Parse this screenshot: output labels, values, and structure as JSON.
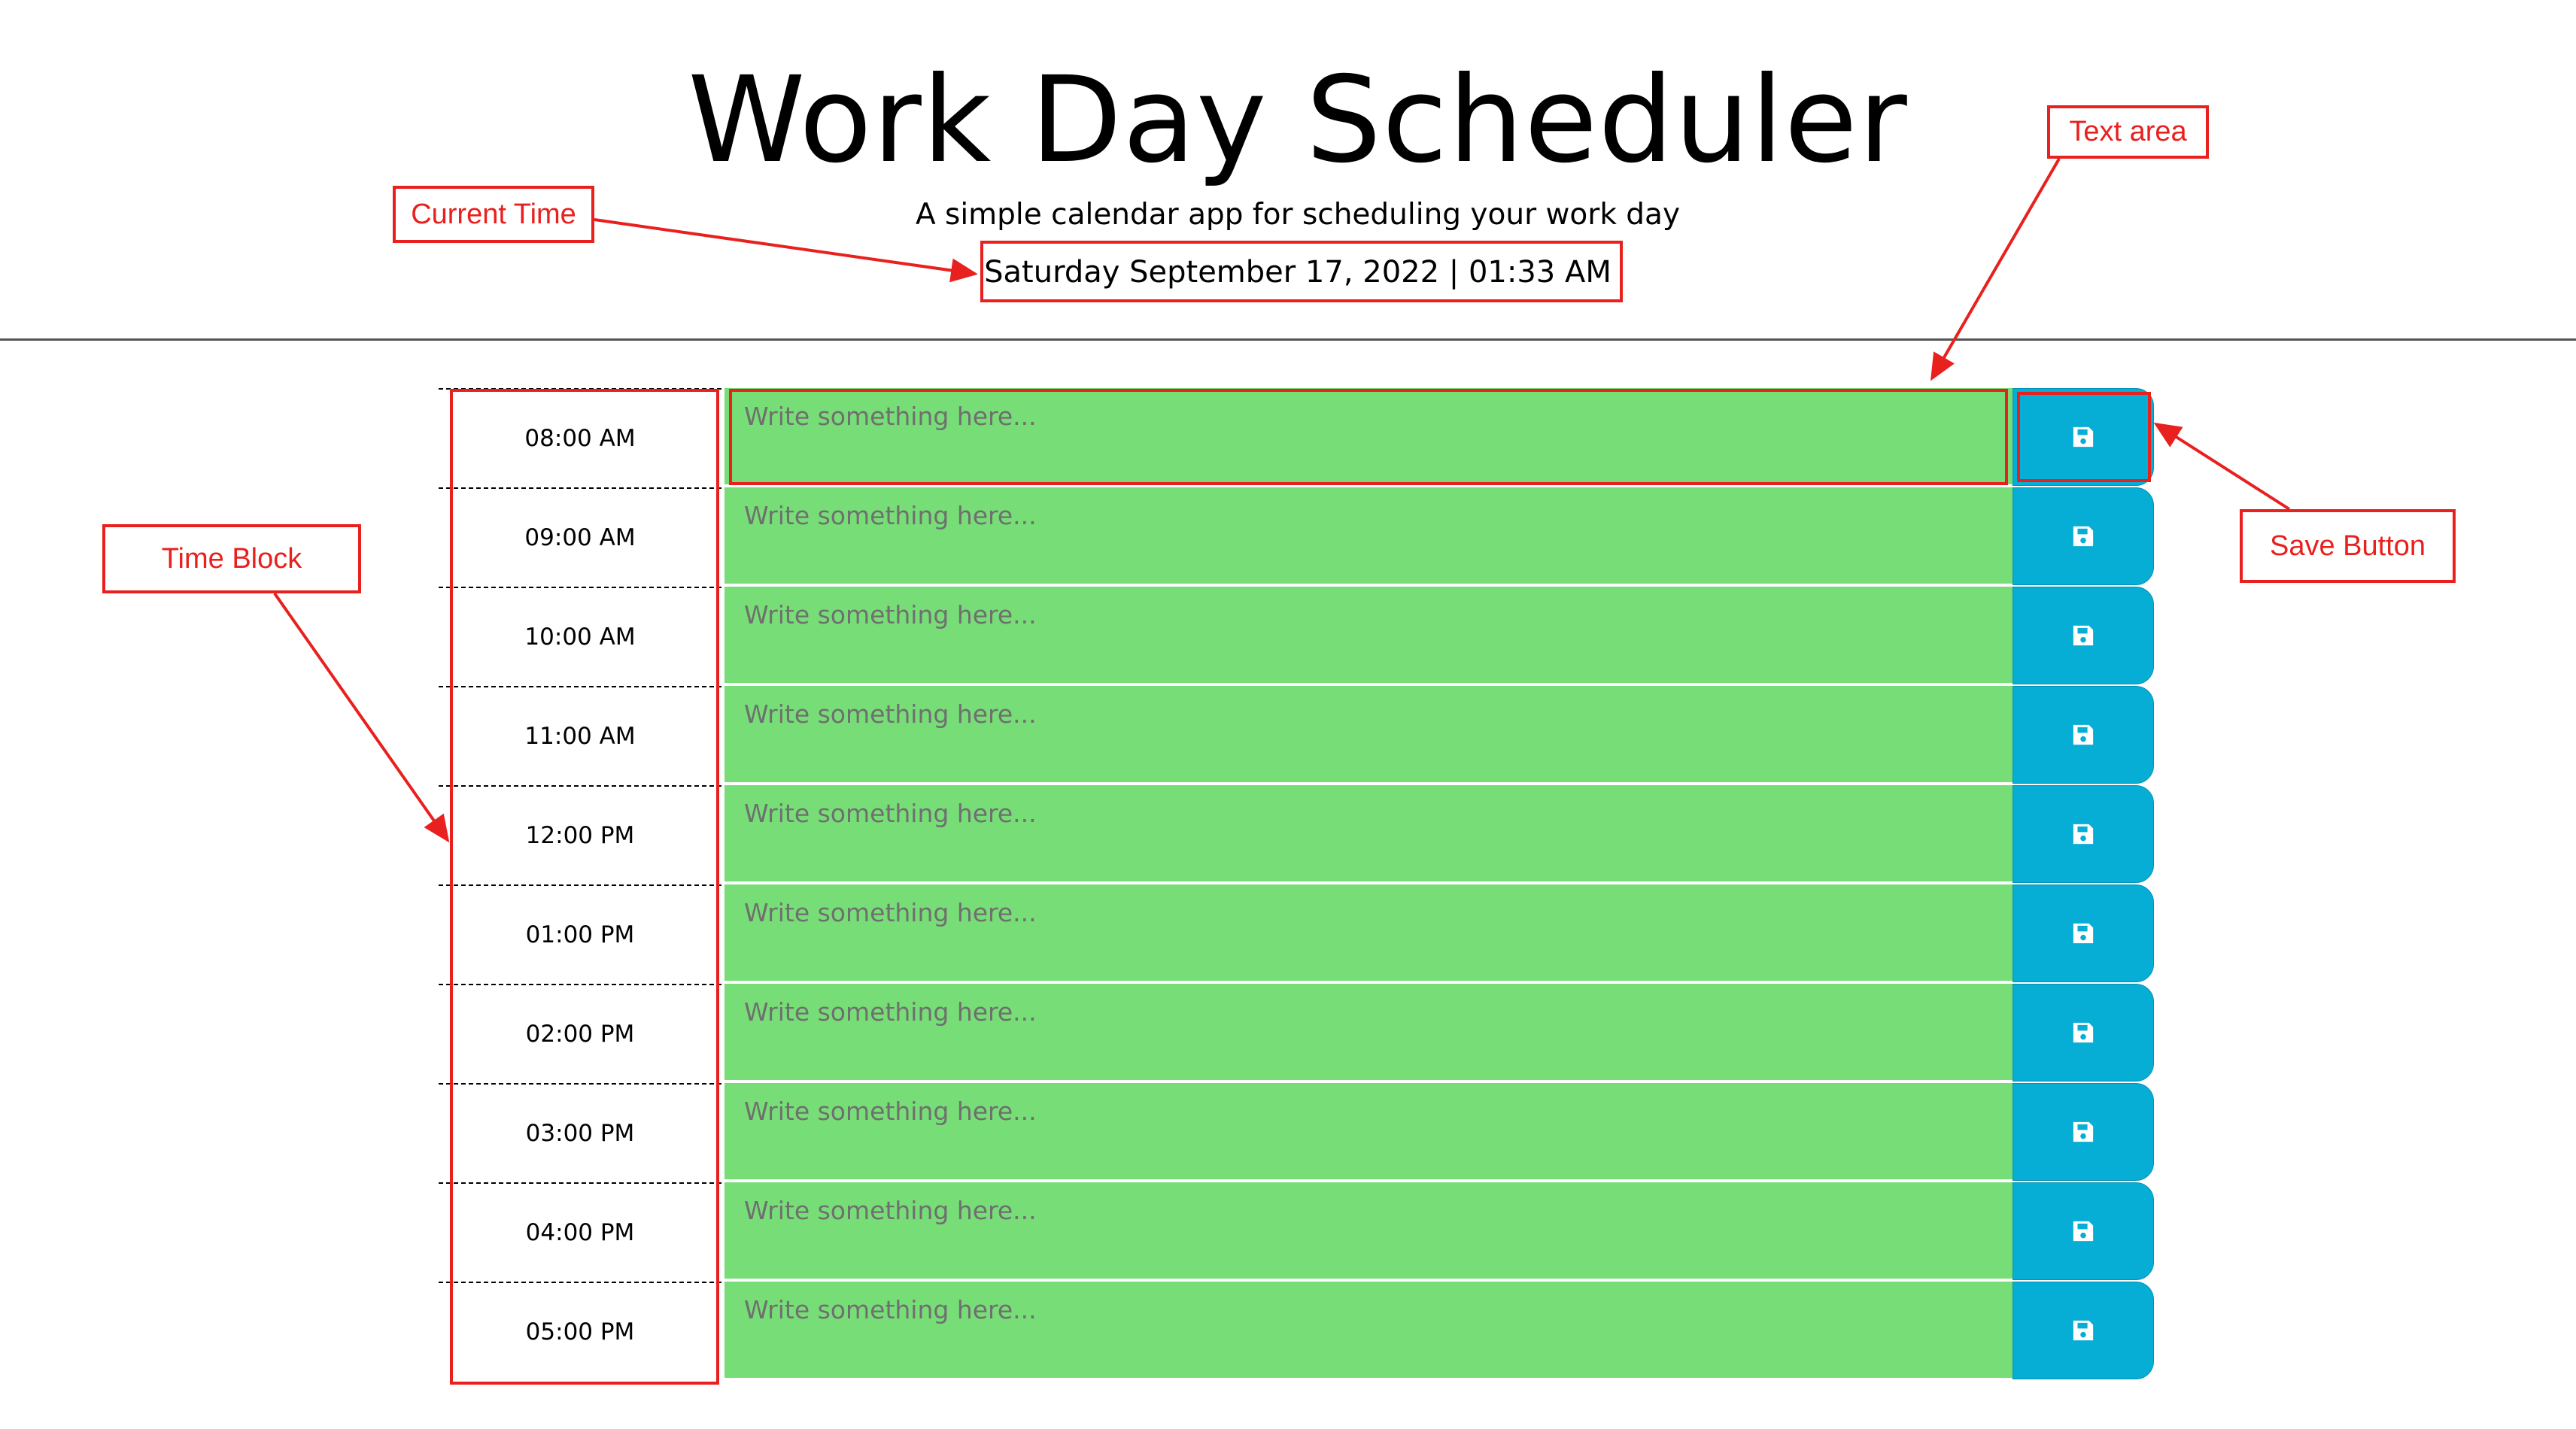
{
  "header": {
    "title": "Work Day Scheduler",
    "subtitle": "A simple calendar app for scheduling your work day",
    "current_day": "Saturday September 17, 2022 | 01:33 AM"
  },
  "schedule": {
    "placeholder": "Write something here...",
    "save_icon": "floppy-disk-icon",
    "colors": {
      "future": "#77dd77",
      "save_button": "#06aed5"
    },
    "rows": [
      {
        "hour": "08:00 AM",
        "text": ""
      },
      {
        "hour": "09:00 AM",
        "text": ""
      },
      {
        "hour": "10:00 AM",
        "text": ""
      },
      {
        "hour": "11:00 AM",
        "text": ""
      },
      {
        "hour": "12:00 PM",
        "text": ""
      },
      {
        "hour": "01:00 PM",
        "text": ""
      },
      {
        "hour": "02:00 PM",
        "text": ""
      },
      {
        "hour": "03:00 PM",
        "text": ""
      },
      {
        "hour": "04:00 PM",
        "text": ""
      },
      {
        "hour": "05:00 PM",
        "text": ""
      }
    ]
  },
  "annotations": {
    "color": "#e8201e",
    "current_time": "Current Time",
    "text_area": "Text area",
    "time_block": "Time Block",
    "save_button": "Save Button"
  }
}
